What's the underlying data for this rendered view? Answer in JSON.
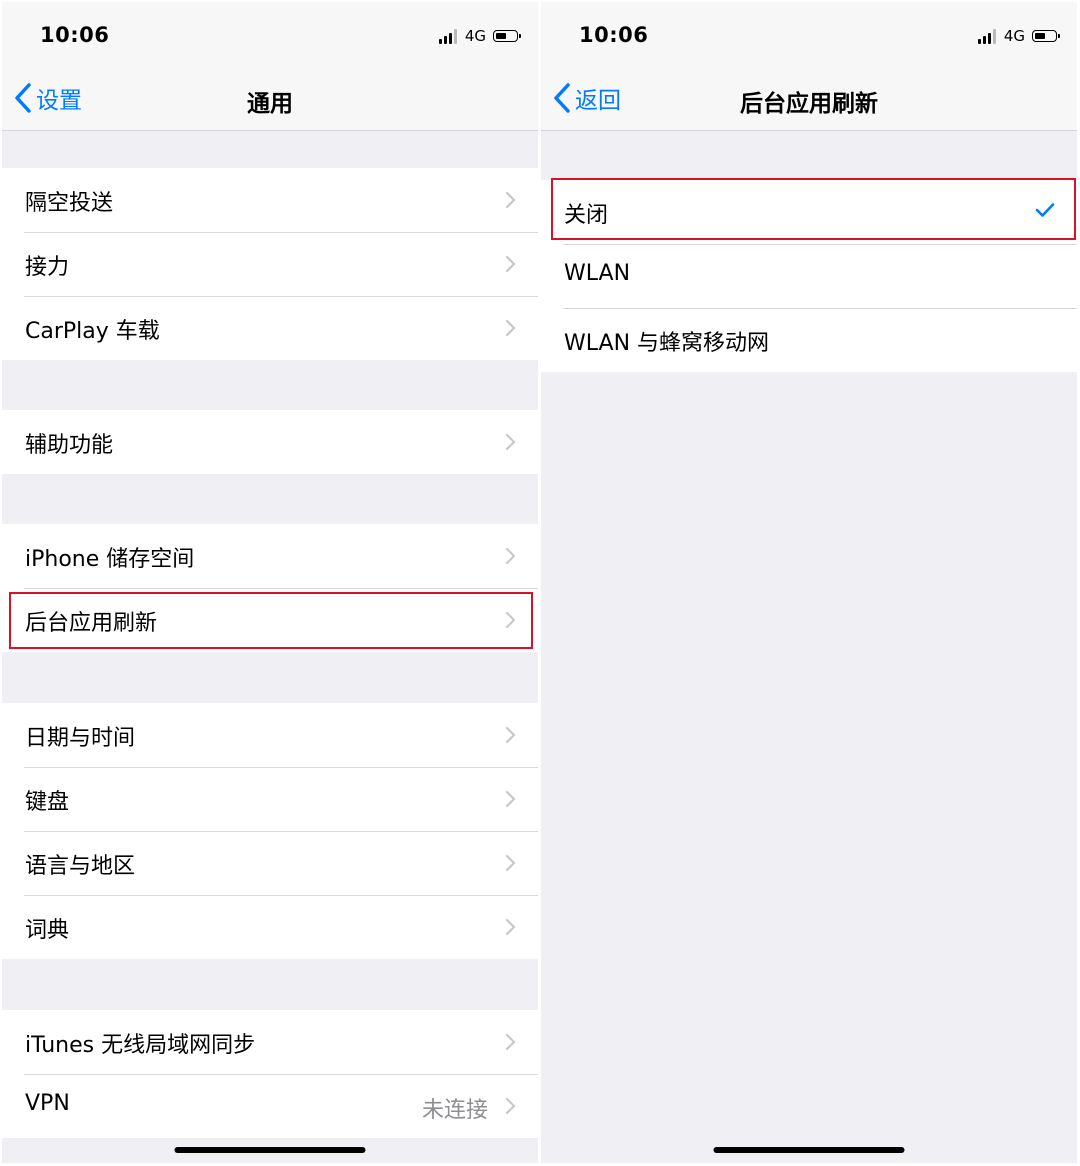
{
  "colors": {
    "accent": "#007aff",
    "highlight": "#d9122a",
    "background": "#efeff4",
    "cell": "#ffffff",
    "secondary_text": "#8e8e93"
  },
  "left": {
    "status": {
      "time": "10:06",
      "network": "4G",
      "signal_bars": 3,
      "battery_level": 0.5
    },
    "nav": {
      "back_label": "设置",
      "title": "通用"
    },
    "groups": [
      {
        "items": [
          "隔空投送",
          "接力",
          "CarPlay 车载"
        ]
      },
      {
        "items": [
          "辅助功能"
        ]
      },
      {
        "items": [
          "iPhone 储存空间",
          "后台应用刷新"
        ]
      },
      {
        "items": [
          "日期与时间",
          "键盘",
          "语言与地区",
          "词典"
        ]
      },
      {
        "items": [
          "iTunes 无线局域网同步",
          "VPN"
        ]
      }
    ],
    "vpn_value": "未连接",
    "highlighted_item": "后台应用刷新"
  },
  "right": {
    "status": {
      "time": "10:06",
      "network": "4G",
      "signal_bars": 3,
      "battery_level": 0.5
    },
    "nav": {
      "back_label": "返回",
      "title": "后台应用刷新"
    },
    "options": [
      "关闭",
      "WLAN",
      "WLAN 与蜂窝移动网"
    ],
    "selected_option": "关闭"
  }
}
